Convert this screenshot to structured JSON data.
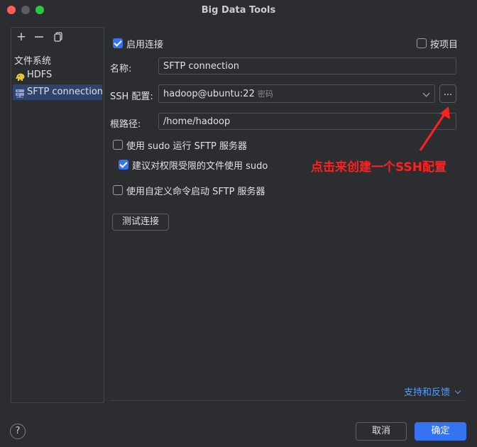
{
  "window": {
    "title": "Big Data Tools"
  },
  "sidebar": {
    "toolbar": {
      "add": "+",
      "remove": "—",
      "copy": "⎘"
    },
    "section_label": "文件系统",
    "items": [
      {
        "label": "HDFS",
        "icon": "hadoop-elephant-icon"
      },
      {
        "label": "SFTP connection",
        "icon": "sftp-server-icon",
        "selected": true
      }
    ]
  },
  "form": {
    "enable_connection": {
      "label": "启用连接",
      "checked": true
    },
    "per_project": {
      "label": "按项目",
      "checked": false
    },
    "name": {
      "label": "名称:",
      "value": "SFTP connection"
    },
    "ssh_config": {
      "label": "SSH 配置:",
      "value": "hadoop@ubuntu:22",
      "hint": "密码",
      "more_label": "..."
    },
    "root_path": {
      "label": "根路径:",
      "value": "/home/hadoop"
    },
    "use_sudo": {
      "label": "使用 sudo 运行 SFTP 服务器",
      "checked": false
    },
    "suggest_sudo": {
      "label": "建议对权限受限的文件使用 sudo",
      "checked": true
    },
    "custom_command": {
      "label": "使用自定义命令启动 SFTP 服务器",
      "checked": false
    },
    "test_button": "测试连接",
    "support_link": "支持和反馈"
  },
  "annotation": {
    "text": "点击来创建一个SSH配置",
    "color": "#ff2020"
  },
  "footer": {
    "help": "?",
    "cancel": "取消",
    "ok": "确定"
  },
  "colors": {
    "accent": "#3574f0",
    "background": "#2b2d30",
    "selection": "#2e436e",
    "link": "#589df6"
  }
}
